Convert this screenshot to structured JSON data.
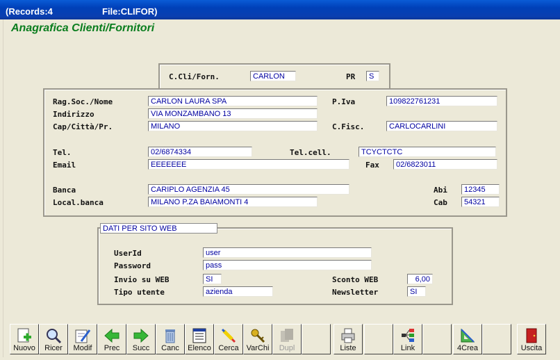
{
  "window": {
    "records": "(Records:4",
    "file": "File:CLIFOR)"
  },
  "form_title": "Anagrafica Clienti/Fornitori",
  "header_box": {
    "code_label": "C.Cli/Forn.",
    "code_value": "CARLON",
    "pr_label": "PR",
    "pr_value": "S"
  },
  "main": {
    "ragsoc_label": "Rag.Soc./Nome",
    "ragsoc_value": "CARLON LAURA SPA",
    "piva_label": "P.Iva",
    "piva_value": "109822761231",
    "indirizzo_label": "Indirizzo",
    "indirizzo_value": "VIA MONZAMBANO 13",
    "cap_label": "Cap/Città/Pr.",
    "cap_value": "MILANO",
    "cfisc_label": "C.Fisc.",
    "cfisc_value": "CARLOCARLINI",
    "tel_label": "Tel.",
    "tel_value": "02/6874334",
    "telcell_label": "Tel.cell.",
    "telcell_value": "TCYCTCTC",
    "email_label": "Email",
    "email_value": "EEEEEEE",
    "fax_label": "Fax",
    "fax_value": "02/6823011",
    "banca_label": "Banca",
    "banca_value": "CARIPLO AGENZIA 45",
    "abi_label": "Abi",
    "abi_value": "12345",
    "local_label": "Local.banca",
    "local_value": "MILANO P.ZA BAIAMONTI 4",
    "cab_label": "Cab",
    "cab_value": "54321"
  },
  "web": {
    "caption": "DATI PER SITO WEB",
    "userid_label": "UserId",
    "userid_value": "user",
    "password_label": "Password",
    "password_value": "pass",
    "invio_label": "Invio su WEB",
    "invio_value": "SI",
    "sconto_label": "Sconto WEB",
    "sconto_value": "6,00",
    "tipo_label": "Tipo utente",
    "tipo_value": "azienda",
    "newsletter_label": "Newsletter",
    "newsletter_value": "SI"
  },
  "toolbar": {
    "nuovo": "Nuovo",
    "ricer": "Ricer",
    "modif": "Modif",
    "prec": "Prec",
    "succ": "Succ",
    "canc": "Canc",
    "elenco": "Elenco",
    "cerca": "Cerca",
    "varchi": "VarChi",
    "dupl": "Dupl",
    "liste": "Liste",
    "link": "Link",
    "crea": "4Crea",
    "uscita": "Uscita"
  },
  "colors": {
    "title_green": "#0a7d1e",
    "field_text": "#0000a0",
    "titlebar_blue": "#0040b8"
  }
}
